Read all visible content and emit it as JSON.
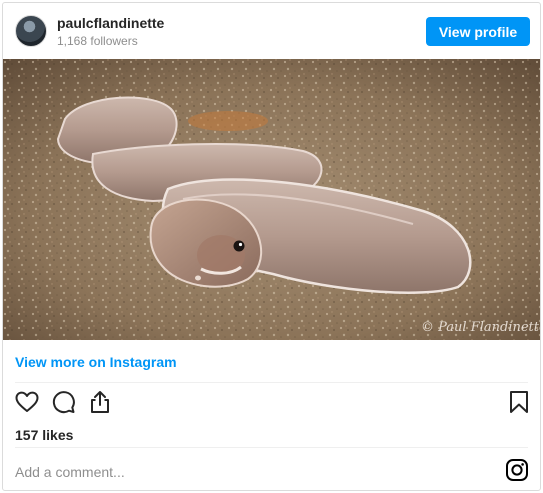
{
  "header": {
    "username": "paulcflandinette",
    "followers": "1,168 followers",
    "view_profile_label": "View profile"
  },
  "photo": {
    "watermark": "© Paul Flandinette"
  },
  "post": {
    "view_more_label": "View more on Instagram",
    "likes": "157 likes",
    "comment_placeholder": "Add a comment..."
  },
  "icons": {
    "like": "heart-icon",
    "comment": "comment-icon",
    "share": "share-icon",
    "save": "bookmark-icon",
    "brand": "instagram-icon"
  },
  "colors": {
    "accent": "#0095f6",
    "text": "#262626",
    "muted": "#8e8e8e",
    "border": "#dbdbdb"
  }
}
